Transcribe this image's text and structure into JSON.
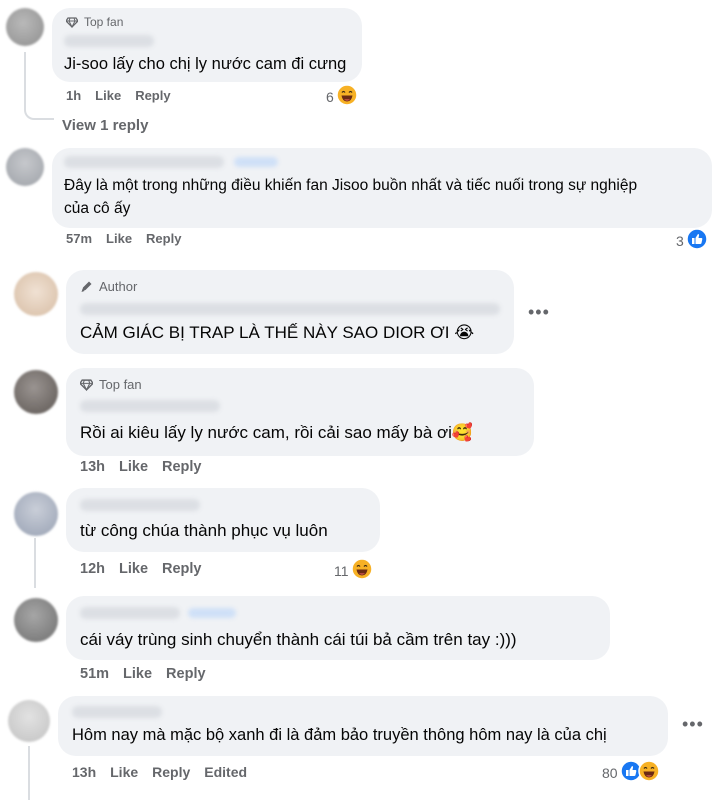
{
  "comments": [
    {
      "badge": "Top fan",
      "text": "Ji-soo lấy cho chị ly nước cam đi cưng",
      "time": "1h",
      "like": "Like",
      "reply": "Reply",
      "reactions": {
        "count": "6",
        "icons": [
          "haha"
        ]
      },
      "view_replies": "View 1 reply"
    },
    {
      "text_line1": "Đây là một trong những điều khiến fan Jisoo buồn nhất và tiếc nuối trong sự nghiệp",
      "text_line2": "của cô ấy",
      "time": "57m",
      "like": "Like",
      "reply": "Reply",
      "reactions": {
        "count": "3",
        "icons": [
          "like"
        ]
      }
    },
    {
      "badge": "Author",
      "text": "CẢM GIÁC BỊ TRAP LÀ THẾ NÀY SAO DIOR ƠI 😭",
      "more": "•••"
    },
    {
      "badge": "Top fan",
      "text": "Rồi ai kiêu lấy ly nước cam, rồi cải sao mấy bà ơi🥰",
      "time": "13h",
      "like": "Like",
      "reply": "Reply"
    },
    {
      "text": "từ công chúa thành phục vụ luôn",
      "time": "12h",
      "like": "Like",
      "reply": "Reply",
      "reactions": {
        "count": "11",
        "icons": [
          "haha"
        ]
      }
    },
    {
      "text": "cái váy trùng sinh chuyển thành cái túi bả cầm trên tay :)))",
      "time": "51m",
      "like": "Like",
      "reply": "Reply"
    },
    {
      "text": "Hôm nay mà mặc bộ xanh đi là đảm bảo truyền thông hôm nay là của chị",
      "time": "13h",
      "like": "Like",
      "reply": "Reply",
      "edited": "Edited",
      "reactions": {
        "count": "80",
        "icons": [
          "like",
          "haha"
        ]
      },
      "more": "•••"
    }
  ],
  "colors": {
    "bubble": "#f0f2f5",
    "meta": "#65676b",
    "like_blue": "#1877f2",
    "haha_yellow": "#f7b125"
  }
}
